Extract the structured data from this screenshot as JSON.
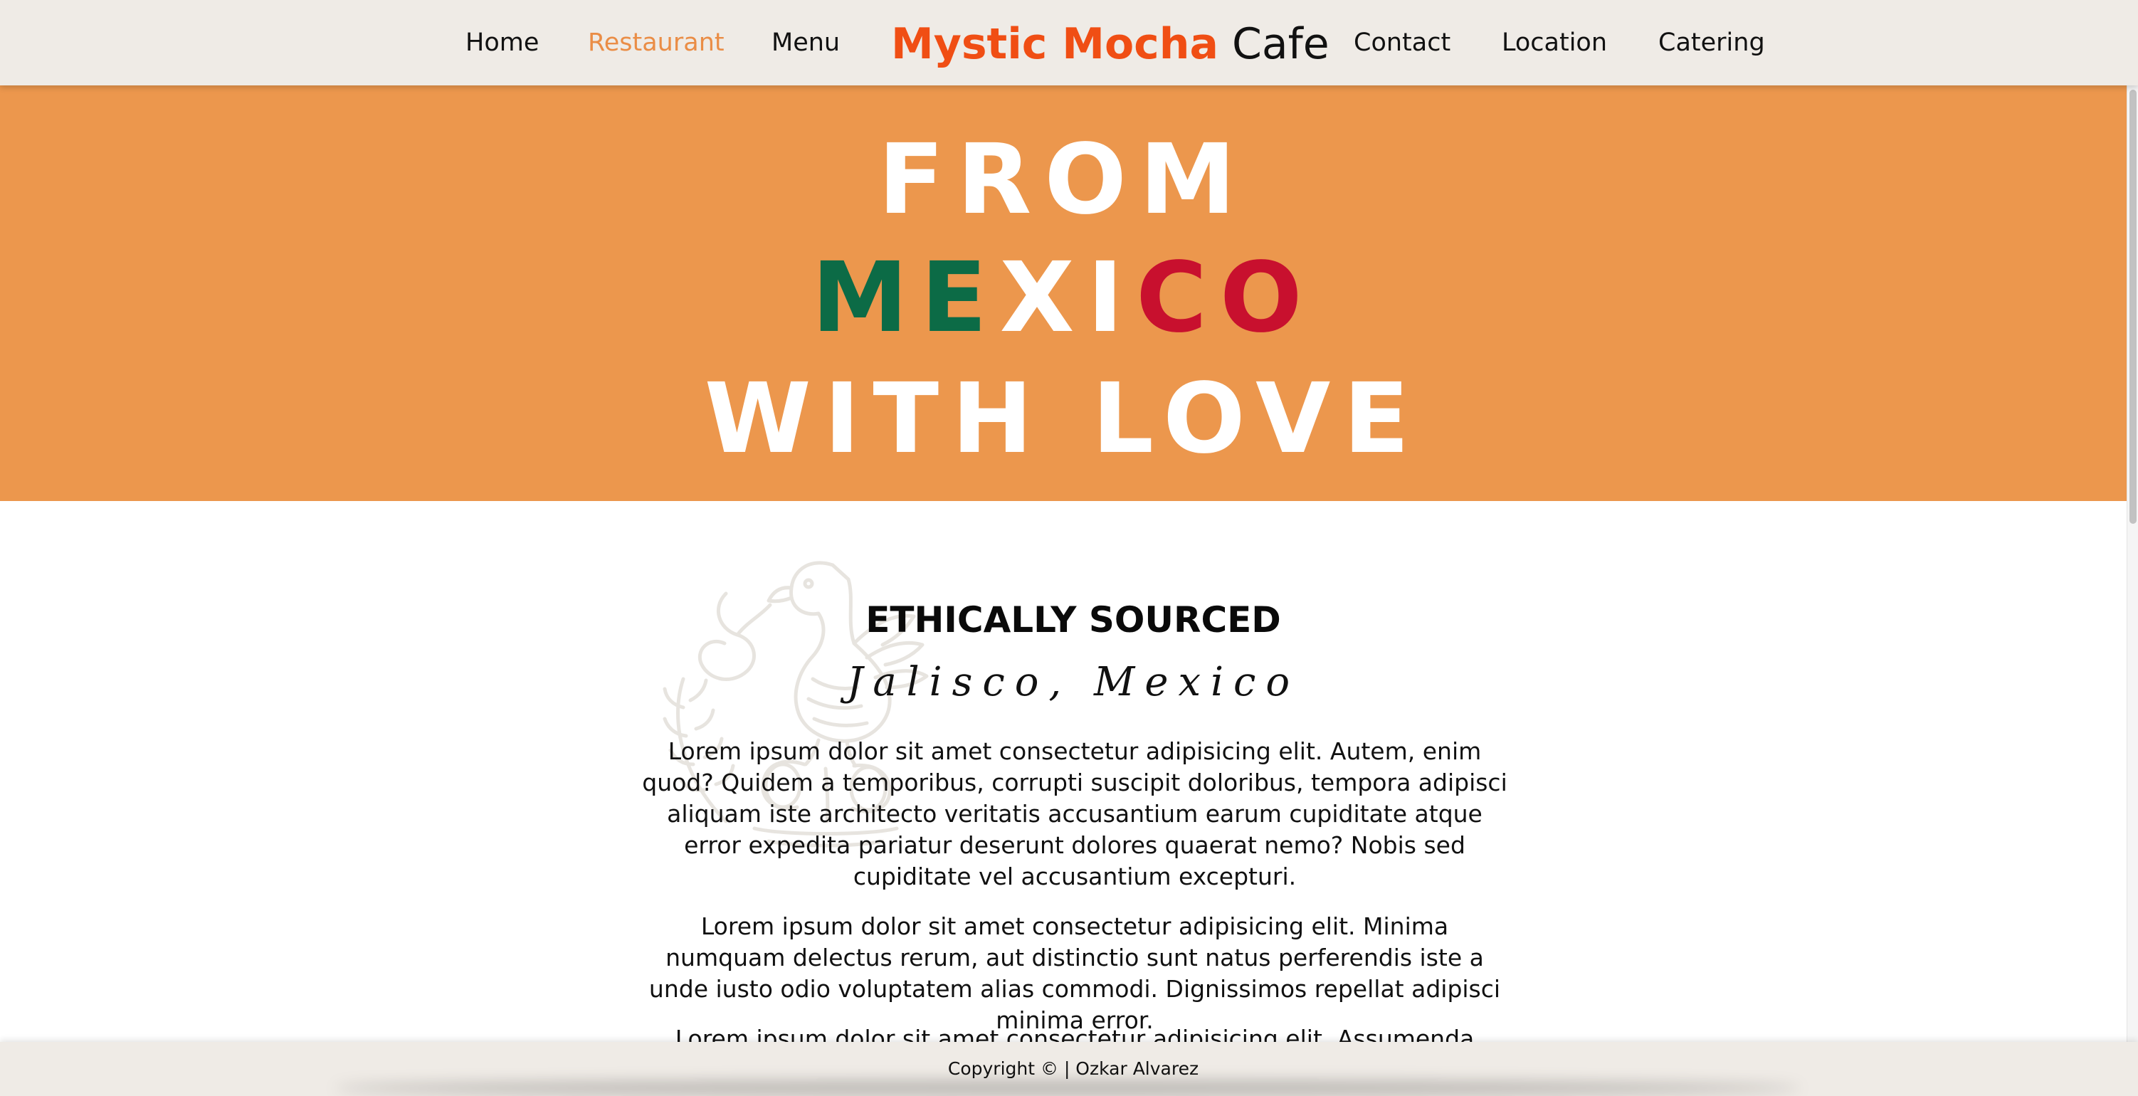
{
  "nav": {
    "links": [
      {
        "label": "Home"
      },
      {
        "label": "Restaurant"
      },
      {
        "label": "Menu"
      },
      {
        "label": "Contact"
      },
      {
        "label": "Location"
      },
      {
        "label": "Catering"
      }
    ],
    "active_link": "Restaurant",
    "brand_accent": "Mystic Mocha",
    "brand_plain": "Cafe"
  },
  "hero": {
    "line1": "FROM",
    "line2_parts": [
      "ME",
      "XI",
      "CO"
    ],
    "line3": "WITH LOVE"
  },
  "content": {
    "title": "ETHICALLY SOURCED",
    "subtitle": "Jalisco, Mexico",
    "paragraphs": [
      "Lorem ipsum dolor sit amet consectetur adipisicing elit. Autem, enim quod? Quidem a temporibus, corrupti suscipit doloribus, tempora adipisci aliquam iste architecto veritatis accusantium earum cupiditate atque error expedita pariatur deserunt dolores quaerat nemo? Nobis sed cupiditate vel accusantium excepturi.",
      "Lorem ipsum dolor sit amet consectetur adipisicing elit. Minima numquam delectus rerum, aut distinctio sunt natus perferendis iste a unde iusto odio voluptatem alias commodi. Dignissimos repellat adipisci minima error.",
      "Lorem ipsum dolor sit amet consectetur adipisicing elit. Assumenda debitis"
    ]
  },
  "footer": {
    "text": "Copyright © | Ozkar Alvarez"
  },
  "icons": {
    "emblem": "mexican-eagle-emblem-icon"
  },
  "colors": {
    "nav_bg": "#efebe6",
    "active_link": "#ea8d46",
    "brand_accent": "#f04e14",
    "hero_bg": "#ec974d",
    "flag_green": "#0c6b46",
    "flag_white": "#ffffff",
    "flag_red": "#c8102e"
  }
}
